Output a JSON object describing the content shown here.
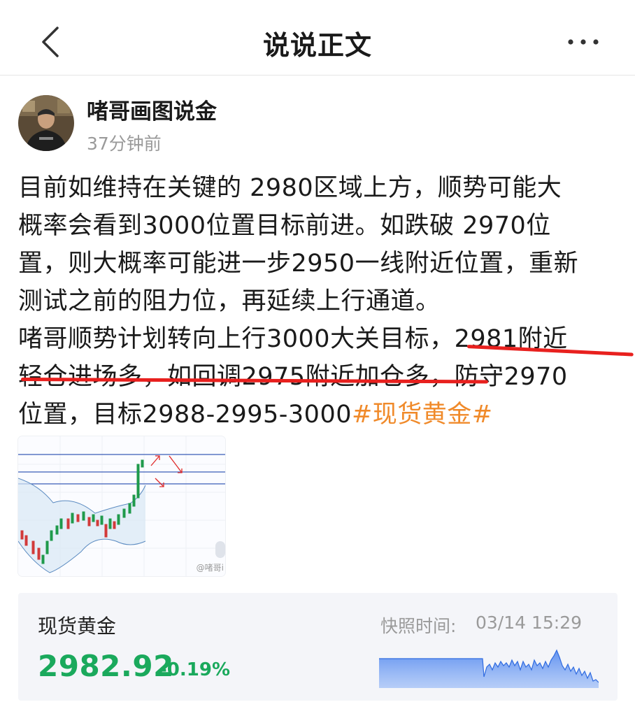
{
  "header": {
    "title": "说说正文",
    "back_icon": "chevron-left-icon",
    "more_icon": "more-dots-icon"
  },
  "author": {
    "name": "啫哥画图说金",
    "time": "37分钟前"
  },
  "post": {
    "lines": [
      "目前如维持在关键的 2980区域上方，顺势可能大",
      "概率会看到3000位置目标前进。如跌破 2970位",
      "置，则大概率可能进一步2950一线附近位置，重新",
      "测试之前的阻力位，再延续上行通道。",
      "啫哥顺势计划转向上行3000大关目标，2981附近",
      "轻仓进场多，如回调2975附近加仓多，防守2970"
    ],
    "last_line_text": "位置，目标2988-2995-3000",
    "hashtag": "#现货黄金#",
    "hashtag_color": "#f08a2a",
    "underline_color": "#e8201e"
  },
  "thumbnail": {
    "watermark": "@啫哥i"
  },
  "quote": {
    "name": "现货黄金",
    "price": "2982.92",
    "change": "-0.19%",
    "snapshot_label": "快照时间:",
    "snapshot_time": "03/14 15:29",
    "price_color": "#1aa95c"
  }
}
